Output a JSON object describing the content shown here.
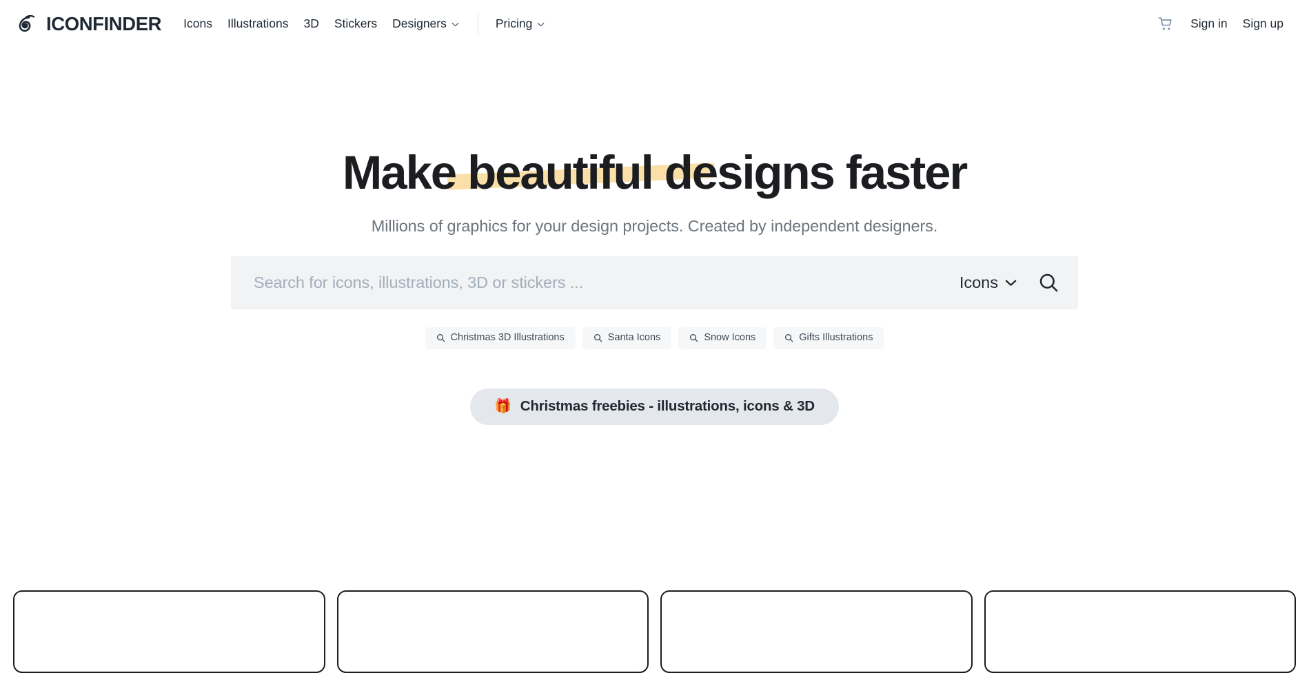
{
  "header": {
    "logo": {
      "icon": "iconfinder-eye-logo-icon",
      "wordmark": "ICONFINDER"
    },
    "nav": [
      {
        "label": "Icons",
        "has_caret": false
      },
      {
        "label": "Illustrations",
        "has_caret": false
      },
      {
        "label": "3D",
        "has_caret": false
      },
      {
        "label": "Stickers",
        "has_caret": false
      },
      {
        "label": "Designers",
        "has_caret": true
      }
    ],
    "nav_secondary": [
      {
        "label": "Pricing",
        "has_caret": true
      }
    ],
    "cart_icon": "shopping-cart-icon",
    "sign_in_label": "Sign in",
    "sign_up_label": "Sign up"
  },
  "hero": {
    "title": "Make beautiful designs faster",
    "highlight_color": "#FBDFA8",
    "subtitle": "Millions of graphics for your design projects. Created by independent designers."
  },
  "search": {
    "placeholder": "Search for icons, illustrations, 3D or stickers ...",
    "value": "",
    "type_selected": "Icons",
    "caret_icon": "chevron-down-icon",
    "submit_icon": "search-icon"
  },
  "suggestions": [
    {
      "icon": "search-icon",
      "label": "Christmas 3D Illustrations"
    },
    {
      "icon": "search-icon",
      "label": "Santa Icons"
    },
    {
      "icon": "search-icon",
      "label": "Snow Icons"
    },
    {
      "icon": "search-icon",
      "label": "Gifts Illustrations"
    }
  ],
  "promo": {
    "emoji": "🎁",
    "label": "Christmas freebies - illustrations, icons & 3D"
  },
  "cards": [
    {
      "name": "category-card-1"
    },
    {
      "name": "category-card-2"
    },
    {
      "name": "category-card-3"
    },
    {
      "name": "category-card-4"
    }
  ],
  "colors": {
    "text_primary": "#1F2933",
    "text_muted": "#6C757D",
    "search_bg": "#F1F3F5",
    "chip_bg": "#F6F7F8",
    "promo_bg": "#E4E7EB",
    "highlight": "#FBDFA8"
  }
}
